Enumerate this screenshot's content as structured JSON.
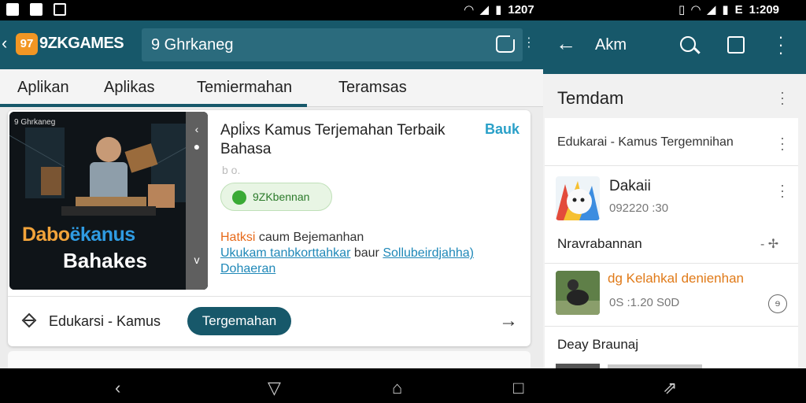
{
  "status_bar": {
    "left_time": "1207",
    "right_time": "1:209",
    "battery_label": "E"
  },
  "left_app": {
    "logo_text": "97",
    "brand": "9ZKGAMES",
    "search_value": "9 Ghrkaneg",
    "tabs": [
      "Aplikan",
      "Aplikas",
      "Temiermahan",
      "Teramsas"
    ],
    "active_tab_index": 0,
    "card": {
      "thumb_top": "9 Ghrkaneg",
      "thumb_title_part1": "Dabo",
      "thumb_title_part2": "ëkanus",
      "thumb_title_line2": "Bahakes",
      "title": "Apli̇xs Kamus Terjemahan Terbaik Bahasa",
      "action": "Bauk",
      "meta": "b o.",
      "developer": "9ZKbennan",
      "desc_highlight": "Hatksi",
      "desc_rest_line1": " caum Bejemanhan",
      "desc_link1": "Ukukam tanbkorttahkar",
      "desc_mid": " baur ",
      "desc_link2": "Sollubeirdjahha)",
      "desc_link3": "Dohaeran",
      "category_label": "Edukarsi  - Kamus",
      "category_chip": "Tergemahan"
    }
  },
  "right_app": {
    "header_title": "Akm",
    "section_title": "Temdam",
    "row1": "Edukarai - Kamus Tergemnihan",
    "contact1_name": "Dakaii",
    "contact1_time": "092220 :30",
    "subheader": "Nravrabannan",
    "contact2_name": "dg Kelahkal denienhan",
    "contact2_time": "0S :1.20 S0D",
    "contact2_badge": "ɘ",
    "footer_label": "Deay Braunaj"
  },
  "colors": {
    "header_teal": "#17586a",
    "accent_orange": "#f29624",
    "link_blue": "#1f88b8"
  }
}
